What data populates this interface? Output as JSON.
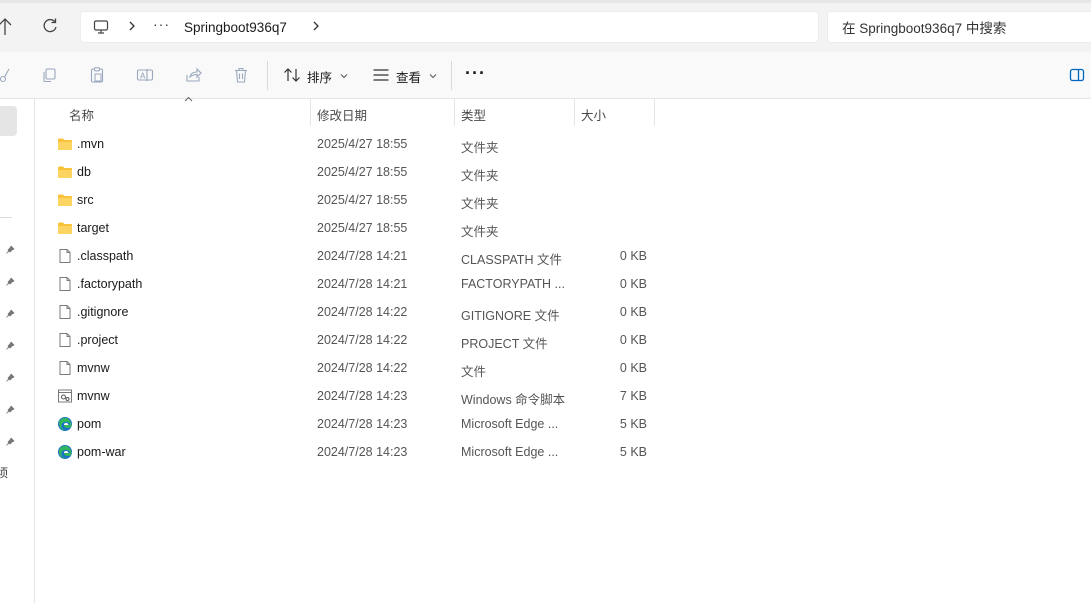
{
  "address": {
    "more_label": "···",
    "folder_name": "Springboot936q7",
    "search_placeholder": "在 Springboot936q7 中搜索"
  },
  "toolbar": {
    "sort_label": "排序",
    "view_label": "查看",
    "more_label": "···"
  },
  "leftnav": {
    "edge_char": "顷"
  },
  "columns": {
    "name": "名称",
    "date": "修改日期",
    "type": "类型",
    "size": "大小"
  },
  "files": [
    {
      "name": ".mvn",
      "date": "2025/4/27 18:55",
      "type": "文件夹",
      "size": "",
      "icon": "folder-icon"
    },
    {
      "name": "db",
      "date": "2025/4/27 18:55",
      "type": "文件夹",
      "size": "",
      "icon": "folder-icon"
    },
    {
      "name": "src",
      "date": "2025/4/27 18:55",
      "type": "文件夹",
      "size": "",
      "icon": "folder-icon"
    },
    {
      "name": "target",
      "date": "2025/4/27 18:55",
      "type": "文件夹",
      "size": "",
      "icon": "folder-icon"
    },
    {
      "name": ".classpath",
      "date": "2024/7/28 14:21",
      "type": "CLASSPATH 文件",
      "size": "0 KB",
      "icon": "file-icon"
    },
    {
      "name": ".factorypath",
      "date": "2024/7/28 14:21",
      "type": "FACTORYPATH ...",
      "size": "0 KB",
      "icon": "file-icon"
    },
    {
      "name": ".gitignore",
      "date": "2024/7/28 14:22",
      "type": "GITIGNORE 文件",
      "size": "0 KB",
      "icon": "file-icon"
    },
    {
      "name": ".project",
      "date": "2024/7/28 14:22",
      "type": "PROJECT 文件",
      "size": "0 KB",
      "icon": "file-icon"
    },
    {
      "name": "mvnw",
      "date": "2024/7/28 14:22",
      "type": "文件",
      "size": "0 KB",
      "icon": "file-icon"
    },
    {
      "name": "mvnw",
      "date": "2024/7/28 14:23",
      "type": "Windows 命令脚本",
      "size": "7 KB",
      "icon": "script-icon"
    },
    {
      "name": "pom",
      "date": "2024/7/28 14:23",
      "type": "Microsoft Edge ...",
      "size": "5 KB",
      "icon": "edge-icon"
    },
    {
      "name": "pom-war",
      "date": "2024/7/28 14:23",
      "type": "Microsoft Edge ...",
      "size": "5 KB",
      "icon": "edge-icon"
    }
  ],
  "colors": {
    "folder": "#f8c33a",
    "edge_blue": "#1a73c9",
    "edge_green": "#33b560",
    "accent": "#0067c0"
  }
}
